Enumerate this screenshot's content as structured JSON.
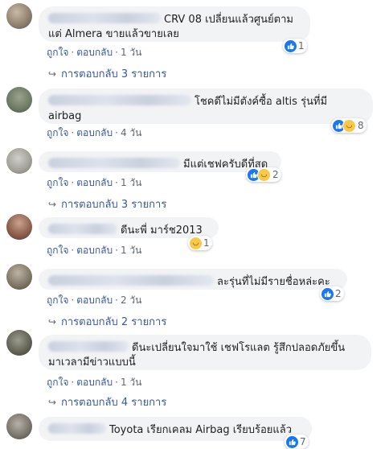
{
  "actions": {
    "like": "ถูกใจ",
    "reply": "ตอบกลับ",
    "sep": "·"
  },
  "icons": {
    "reply_arrow": "↪"
  },
  "comments": [
    {
      "text": "CRV 08 เปลี่ยนแล้วศูนย์ตาม",
      "text2": "แต่ Almera ขายแล้วขายเลย",
      "time": "1 วัน",
      "reactions": {
        "count": "1"
      },
      "replies": "การตอบกลับ 3 รายการ"
    },
    {
      "text": "โชคดีไม่มีตังค์ซื้อ altis รุ่นที่มี",
      "text2": "airbag",
      "time": "4 วัน",
      "reactions": {
        "count": "8"
      }
    },
    {
      "text": "มีแต่เชฟครับดีที่สุด",
      "time": "1 วัน",
      "reactions": {
        "count": "2"
      },
      "replies": "การตอบกลับ 3 รายการ"
    },
    {
      "text": "ดีนะพี่ มาร์ช2013",
      "time": "1 วัน",
      "reactions": {
        "count": "1"
      }
    },
    {
      "text": "ละรุ่นที่ไม่มีรายชื่อหล่ะคะ",
      "time": "2 วัน",
      "reactions": {
        "count": "2"
      },
      "replies": "การตอบกลับ 2 รายการ"
    },
    {
      "text": "ดีนะเปลี่ยนใจมาใช้ เชฟโรแลต รู้สึกปลอดภัยขึ้น",
      "text2": "มาเวลามีข่าวแบบนี้",
      "time": "1 วัน",
      "replies": "การตอบกลับ 4 รายการ"
    },
    {
      "text": "Toyota เรียกเคลม Airbag เรียบร้อยแล้ว",
      "reactions": {
        "count": "7"
      }
    }
  ],
  "colors": {
    "bubble": "#f2f3f5",
    "link": "#385898",
    "meta": "#606770",
    "like": "#1877f2",
    "haha": "#f7c84a"
  }
}
